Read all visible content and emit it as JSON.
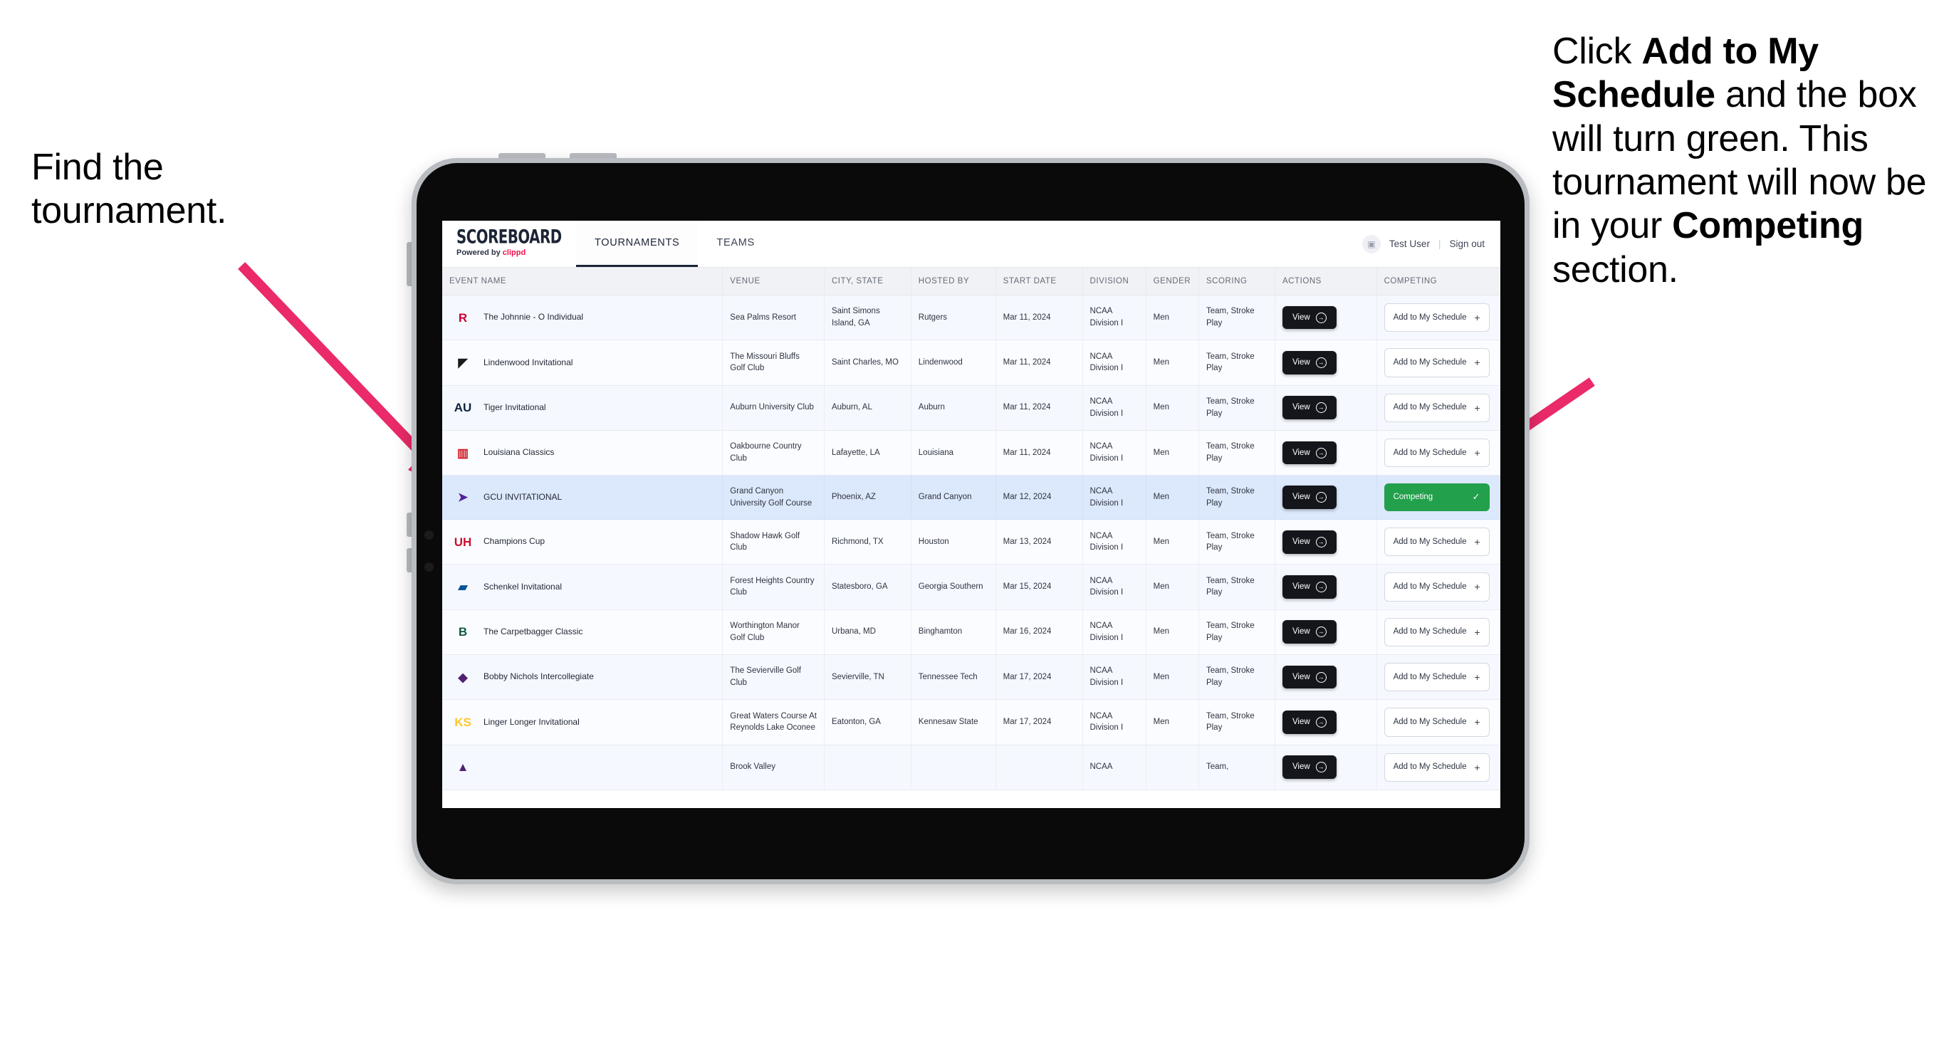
{
  "annotations": {
    "left": {
      "text": "Find the tournament."
    },
    "right": {
      "part1": "Click ",
      "bold1": "Add to My Schedule",
      "part2": " and the box will turn green. This tournament will now be in your ",
      "bold2": "Competing",
      "part3": " section."
    },
    "arrow_color": "#ea2a69"
  },
  "app": {
    "logo": {
      "word": "SCOREBOARD",
      "sub_prefix": "Powered by ",
      "sub_brand": "clippd"
    },
    "tabs": [
      {
        "label": "TOURNAMENTS",
        "active": true
      },
      {
        "label": "TEAMS",
        "active": false
      }
    ],
    "header_right": {
      "avatar_icon": "user-avatar-icon",
      "user": "Test User",
      "separator": "|",
      "sign_out": "Sign out"
    }
  },
  "table": {
    "columns": [
      "EVENT NAME",
      "VENUE",
      "CITY, STATE",
      "HOSTED BY",
      "START DATE",
      "DIVISION",
      "GENDER",
      "SCORING",
      "ACTIONS",
      "COMPETING"
    ],
    "buttons": {
      "view": "View",
      "view_icon": "arrow-circle-right-icon",
      "add": "Add to My Schedule",
      "add_icon": "plus-icon",
      "competing": "Competing",
      "competing_icon": "check-icon"
    },
    "rows": [
      {
        "logo": {
          "name": "rutgers-logo",
          "text": "R",
          "color": "#cc0033",
          "bg": "transparent"
        },
        "event": "The Johnnie - O Individual",
        "venue": "Sea Palms Resort",
        "city": "Saint Simons Island, GA",
        "host": "Rutgers",
        "date": "Mar 11, 2024",
        "division": "NCAA Division I",
        "gender": "Men",
        "scoring": "Team, Stroke Play",
        "competing": false
      },
      {
        "logo": {
          "name": "lindenwood-logo",
          "text": "◤",
          "color": "#1a1a1a",
          "bg": "transparent"
        },
        "event": "Lindenwood Invitational",
        "venue": "The Missouri Bluffs Golf Club",
        "city": "Saint Charles, MO",
        "host": "Lindenwood",
        "date": "Mar 11, 2024",
        "division": "NCAA Division I",
        "gender": "Men",
        "scoring": "Team, Stroke Play",
        "competing": false
      },
      {
        "logo": {
          "name": "auburn-logo",
          "text": "AU",
          "color": "#0c2340",
          "bg": "transparent"
        },
        "event": "Tiger Invitational",
        "venue": "Auburn University Club",
        "city": "Auburn, AL",
        "host": "Auburn",
        "date": "Mar 11, 2024",
        "division": "NCAA Division I",
        "gender": "Men",
        "scoring": "Team, Stroke Play",
        "competing": false
      },
      {
        "logo": {
          "name": "louisiana-ragin-cajuns-logo",
          "text": "▥",
          "color": "#ce181e",
          "bg": "transparent"
        },
        "event": "Louisiana Classics",
        "venue": "Oakbourne Country Club",
        "city": "Lafayette, LA",
        "host": "Louisiana",
        "date": "Mar 11, 2024",
        "division": "NCAA Division I",
        "gender": "Men",
        "scoring": "Team, Stroke Play",
        "competing": false
      },
      {
        "logo": {
          "name": "grand-canyon-lopes-logo",
          "text": "➤",
          "color": "#522398",
          "bg": "transparent"
        },
        "event": "GCU INVITATIONAL",
        "venue": "Grand Canyon University Golf Course",
        "city": "Phoenix, AZ",
        "host": "Grand Canyon",
        "date": "Mar 12, 2024",
        "division": "NCAA Division I",
        "gender": "Men",
        "scoring": "Team, Stroke Play",
        "competing": true,
        "highlight": true
      },
      {
        "logo": {
          "name": "houston-cougars-logo",
          "text": "UH",
          "color": "#c8102e",
          "bg": "transparent"
        },
        "event": "Champions Cup",
        "venue": "Shadow Hawk Golf Club",
        "city": "Richmond, TX",
        "host": "Houston",
        "date": "Mar 13, 2024",
        "division": "NCAA Division I",
        "gender": "Men",
        "scoring": "Team, Stroke Play",
        "competing": false
      },
      {
        "logo": {
          "name": "georgia-southern-logo",
          "text": "▰",
          "color": "#01549b",
          "bg": "transparent"
        },
        "event": "Schenkel Invitational",
        "venue": "Forest Heights Country Club",
        "city": "Statesboro, GA",
        "host": "Georgia Southern",
        "date": "Mar 15, 2024",
        "division": "NCAA Division I",
        "gender": "Men",
        "scoring": "Team, Stroke Play",
        "competing": false
      },
      {
        "logo": {
          "name": "binghamton-bearcats-logo",
          "text": "B",
          "color": "#0d5c3e",
          "bg": "transparent"
        },
        "event": "The Carpetbagger Classic",
        "venue": "Worthington Manor Golf Club",
        "city": "Urbana, MD",
        "host": "Binghamton",
        "date": "Mar 16, 2024",
        "division": "NCAA Division I",
        "gender": "Men",
        "scoring": "Team, Stroke Play",
        "competing": false
      },
      {
        "logo": {
          "name": "tennessee-tech-golden-eagles-logo",
          "text": "◆",
          "color": "#4f2170",
          "bg": "transparent"
        },
        "event": "Bobby Nichols Intercollegiate",
        "venue": "The Sevierville Golf Club",
        "city": "Sevierville, TN",
        "host": "Tennessee Tech",
        "date": "Mar 17, 2024",
        "division": "NCAA Division I",
        "gender": "Men",
        "scoring": "Team, Stroke Play",
        "competing": false
      },
      {
        "logo": {
          "name": "kennesaw-state-owls-logo",
          "text": "KS",
          "color": "#ffc629",
          "bg": "transparent"
        },
        "event": "Linger Longer Invitational",
        "venue": "Great Waters Course At Reynolds Lake Oconee",
        "city": "Eatonton, GA",
        "host": "Kennesaw State",
        "date": "Mar 17, 2024",
        "division": "NCAA Division I",
        "gender": "Men",
        "scoring": "Team, Stroke Play",
        "competing": false
      }
    ],
    "cut_row": {
      "logo": {
        "name": "partial-team-logo",
        "text": "▲",
        "color": "#4f2170",
        "bg": "transparent"
      },
      "event": "",
      "venue": "Brook Valley",
      "city": "",
      "host": "",
      "date": "",
      "division": "NCAA",
      "gender": "",
      "scoring": "Team,",
      "competing": false
    }
  }
}
